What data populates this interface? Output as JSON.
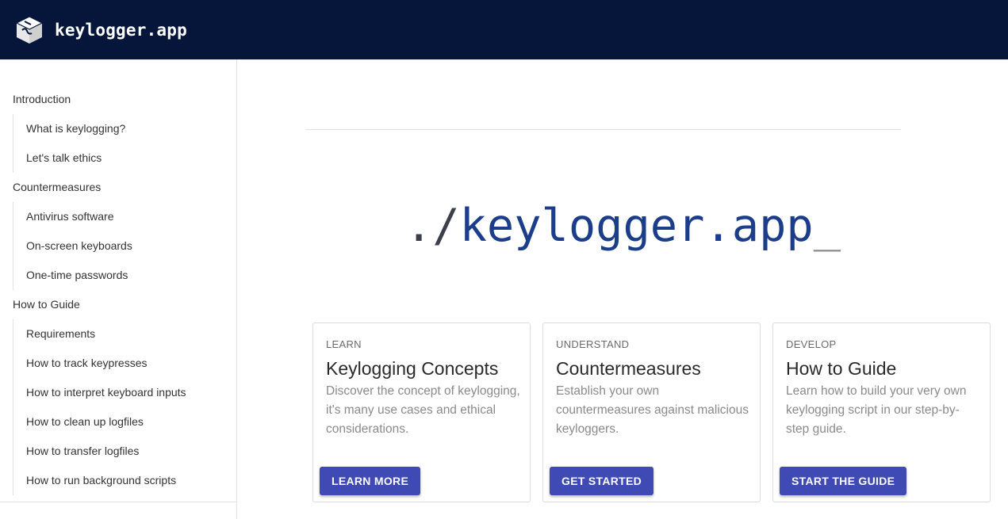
{
  "header": {
    "title": "keylogger.app",
    "logo_icon": "keyboard-key-icon",
    "background": "#05163a"
  },
  "sidebar": {
    "sections": [
      {
        "label": "Introduction",
        "items": [
          "What is keylogging?",
          "Let's talk ethics"
        ]
      },
      {
        "label": "Countermeasures",
        "items": [
          "Antivirus software",
          "On-screen keyboards",
          "One-time passwords"
        ]
      },
      {
        "label": "How to Guide",
        "items": [
          "Requirements",
          "How to track keypresses",
          "How to interpret keyboard inputs",
          "How to clean up logfiles",
          "How to transfer logfiles",
          "How to run background scripts"
        ]
      }
    ]
  },
  "hero": {
    "prefix": "./",
    "name": "keylogger.app",
    "cursor": "_"
  },
  "cards": [
    {
      "eyebrow": "LEARN",
      "title": "Keylogging Concepts",
      "description": "Discover the concept of keylogging, it's many use cases and ethical considerations.",
      "button": "LEARN MORE"
    },
    {
      "eyebrow": "UNDERSTAND",
      "title": "Countermeasures",
      "description": "Establish your own countermeasures against malicious keyloggers.",
      "button": "GET STARTED"
    },
    {
      "eyebrow": "DEVELOP",
      "title": "How to Guide",
      "description": "Learn how to build your very own keylogging script in our step-by-step guide.",
      "button": "START THE GUIDE"
    }
  ],
  "colors": {
    "accent": "#3f4ab5",
    "hero_name": "#1c3d8a",
    "hero_prefix": "#3a3f4a"
  }
}
